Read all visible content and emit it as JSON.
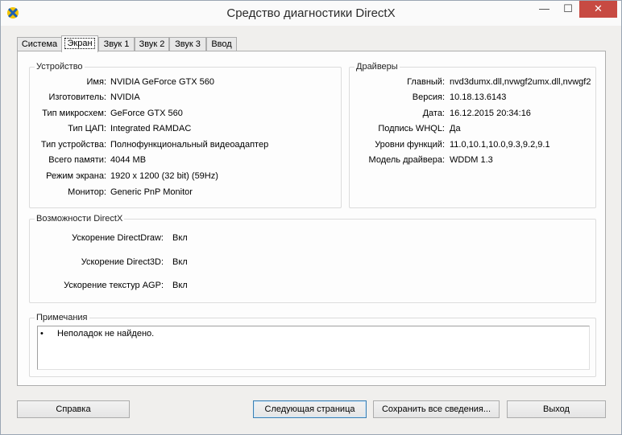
{
  "window": {
    "title": "Средство диагностики DirectX",
    "minimize_glyph": "—",
    "maximize_glyph": "☐",
    "close_glyph": "✕"
  },
  "tabs": [
    {
      "label": "Система"
    },
    {
      "label": "Экран",
      "active": true
    },
    {
      "label": "Звук 1"
    },
    {
      "label": "Звук 2"
    },
    {
      "label": "Звук 3"
    },
    {
      "label": "Ввод"
    }
  ],
  "device": {
    "title": "Устройство",
    "rows": [
      {
        "label": "Имя:",
        "value": "NVIDIA GeForce GTX 560"
      },
      {
        "label": "Изготовитель:",
        "value": "NVIDIA"
      },
      {
        "label": "Тип микросхем:",
        "value": "GeForce GTX 560"
      },
      {
        "label": "Тип ЦАП:",
        "value": "Integrated RAMDAC"
      },
      {
        "label": "Тип устройства:",
        "value": "Полнофункциональный видеоадаптер"
      },
      {
        "label": "Всего памяти:",
        "value": "4044 MB"
      },
      {
        "label": "Режим экрана:",
        "value": "1920 x 1200 (32 bit) (59Hz)"
      },
      {
        "label": "Монитор:",
        "value": "Generic PnP Monitor"
      }
    ]
  },
  "drivers": {
    "title": "Драйверы",
    "rows": [
      {
        "label": "Главный:",
        "value": "nvd3dumx.dll,nvwgf2umx.dll,nvwgf2"
      },
      {
        "label": "Версия:",
        "value": "10.18.13.6143"
      },
      {
        "label": "Дата:",
        "value": "16.12.2015 20:34:16"
      },
      {
        "label": "Подпись WHQL:",
        "value": "Да"
      },
      {
        "label": "Уровни функций:",
        "value": "11.0,10.1,10.0,9.3,9.2,9.1"
      },
      {
        "label": "Модель драйвера:",
        "value": "WDDM 1.3"
      }
    ]
  },
  "directx_features": {
    "title": "Возможности DirectX",
    "rows": [
      {
        "label": "Ускорение DirectDraw:",
        "value": "Вкл"
      },
      {
        "label": "Ускорение Direct3D:",
        "value": "Вкл"
      },
      {
        "label": "Ускорение текстур AGP:",
        "value": "Вкл"
      }
    ]
  },
  "notes": {
    "title": "Примечания",
    "bullet": "•",
    "items": [
      "Неполадок не найдено."
    ]
  },
  "buttons": {
    "help": "Справка",
    "next_page": "Следующая страница",
    "save_all": "Сохранить все сведения...",
    "exit": "Выход"
  },
  "colors": {
    "close_button": "#c74a42",
    "window_bg": "#f0efed",
    "panel_bg": "#fdfdfd",
    "default_button_border": "#3c7fb1"
  }
}
